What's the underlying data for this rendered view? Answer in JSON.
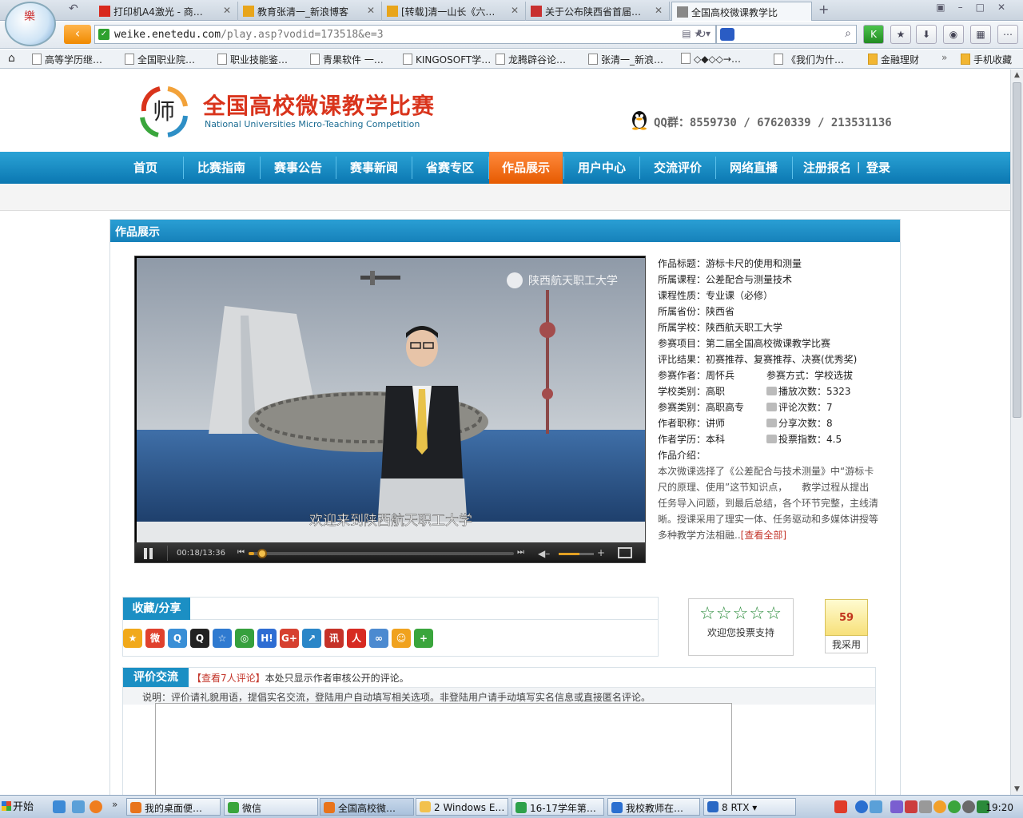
{
  "browser": {
    "tabs": [
      {
        "label": "打印机A4激光 - 商…",
        "icon": "jd-icon",
        "color": "#d8291e",
        "active": false
      },
      {
        "label": "教育张清一_新浪博客",
        "icon": "blog-icon",
        "color": "#e8a51b",
        "active": false
      },
      {
        "label": "[转载]清一山长《六…",
        "icon": "blog-icon",
        "color": "#e8a51b",
        "active": false
      },
      {
        "label": "关于公布陕西省首届…",
        "icon": "leaf-icon",
        "color": "#c83030",
        "active": false
      },
      {
        "label": "全国高校微课教学比",
        "icon": "page-icon",
        "color": "#888888",
        "active": true
      }
    ],
    "url_host": "weike.enetedu.com",
    "url_path": "/play.asp?vodid=173518&e=3",
    "bookmarks": [
      {
        "label": "高等学历继…",
        "type": "page"
      },
      {
        "label": "全国职业院…",
        "type": "page"
      },
      {
        "label": "职业技能鉴…",
        "type": "page"
      },
      {
        "label": "青果软件 一…",
        "type": "page"
      },
      {
        "label": "KINGOSOFT学…",
        "type": "page"
      },
      {
        "label": "龙腾辟谷论…",
        "type": "page"
      },
      {
        "label": "张清一_新浪…",
        "type": "page"
      },
      {
        "label": "◇◆◇◇→…",
        "type": "page"
      },
      {
        "label": "《我们为什…",
        "type": "page"
      },
      {
        "label": "金融理财",
        "type": "folder"
      },
      {
        "label": "手机收藏",
        "type": "folder"
      }
    ],
    "bookmarks_more": "»"
  },
  "site": {
    "title": "全国高校微课教学比赛",
    "subtitle": "National Universities Micro-Teaching Competition",
    "qq": "QQ群：8559730 / 67620339 / 213531136",
    "nav": [
      "首页",
      "比赛指南",
      "赛事公告",
      "赛事新闻",
      "省赛专区",
      "作品展示",
      "用户中心",
      "交流评价",
      "网络直播"
    ],
    "nav_active": "作品展示",
    "register": "注册报名",
    "login": "登录"
  },
  "section": {
    "title": "作品展示"
  },
  "video": {
    "watermark": "陕西航天职工大学",
    "subtitle": "欢迎来到陕西航天职工大学",
    "time": "00:18/13:36",
    "progress": 0.022,
    "volume": 0.6
  },
  "info": {
    "title": "作品标题：游标卡尺的使用和测量",
    "course": "所属课程：公差配合与测量技术",
    "nature": "课程性质：专业课（必修）",
    "province": "所属省份：陕西省",
    "school": "所属学校：陕西航天职工大学",
    "project": "参赛项目：第二届全国高校微课教学比赛",
    "result": "评比结果：初赛推荐、复赛推荐、决赛(优秀奖)",
    "author": "参赛作者：周怀兵",
    "method": "参赛方式：学校选拔",
    "school_type": "学校类别：高职",
    "plays": "播放次数：5323",
    "category": "参赛类别：高职高专",
    "comments": "评论次数：7",
    "rank": "作者职称：讲师",
    "shares": "分享次数：8",
    "education": "作者学历：本科",
    "vote_index": "投票指数：4.5",
    "intro_label": "作品介绍：",
    "intro": "本次微课选择了《公差配合与技术测量》中“游标卡尺的原理、使用”这节知识点，　　教学过程从提出任务导入问题，到最后总结，各个环节完整，主线清晰。授课采用了理实一体、任务驱动和多媒体讲授等多种教学方法相融..",
    "intro_more": "[查看全部]"
  },
  "share": {
    "title": "收藏/分享",
    "icons": [
      {
        "name": "favorite-icon",
        "color": "#f1a91b",
        "glyph": "★"
      },
      {
        "name": "weibo-icon",
        "color": "#e0412d",
        "glyph": "微"
      },
      {
        "name": "qzone-icon",
        "color": "#3a8fd6",
        "glyph": "Q"
      },
      {
        "name": "qq-icon",
        "color": "#222222",
        "glyph": "Q"
      },
      {
        "name": "bookmark-star-icon",
        "color": "#2f7ad0",
        "glyph": "☆"
      },
      {
        "name": "chrome-icon",
        "color": "#36a03d",
        "glyph": "◎"
      },
      {
        "name": "hexun-icon",
        "color": "#2e6dd3",
        "glyph": "H!"
      },
      {
        "name": "google-plus-icon",
        "color": "#d64030",
        "glyph": "G+"
      },
      {
        "name": "share-arrow-icon",
        "color": "#2a86c8",
        "glyph": "↗"
      },
      {
        "name": "news-icon",
        "color": "#c53228",
        "glyph": "讯"
      },
      {
        "name": "renren-icon",
        "color": "#d72a22",
        "glyph": "人"
      },
      {
        "name": "kaixin-icon",
        "color": "#4c8ad0",
        "glyph": "∞"
      },
      {
        "name": "smile-icon",
        "color": "#f0a21e",
        "glyph": "☺"
      },
      {
        "name": "more-plus-icon",
        "color": "#3aa53c",
        "glyph": "+"
      }
    ]
  },
  "vote": {
    "stars": "☆☆☆☆☆",
    "text": "欢迎您投票支持"
  },
  "adopt": {
    "count": "59",
    "label": "我采用"
  },
  "comments": {
    "title": "评价交流",
    "link": "【查看7人评论】",
    "stat_text": "本处只显示作者审核公开的评论。",
    "note": "说明：评价请礼貌用语，提倡实名交流，登陆用户自动填写相关选项。非登陆用户请手动填写实名信息或直接匿名评论。"
  },
  "taskbar": {
    "start": "开始",
    "tasks": [
      {
        "label": "我的桌面便…",
        "color": "#e8741c",
        "active": false
      },
      {
        "label": "微信",
        "color": "#3aa53c",
        "active": false
      },
      {
        "label": "全国高校微…",
        "color": "#e8741c",
        "active": true
      },
      {
        "label": "2 Windows E… ▾",
        "color": "#f2c14e",
        "active": false
      },
      {
        "label": "16-17学年第…",
        "color": "#2ea14a",
        "active": false
      },
      {
        "label": "我校教师在…",
        "color": "#2b6fd0",
        "active": false
      },
      {
        "label": "8 RTX ▾",
        "color": "#2a68c4",
        "active": false
      }
    ],
    "clock": "19:20"
  }
}
